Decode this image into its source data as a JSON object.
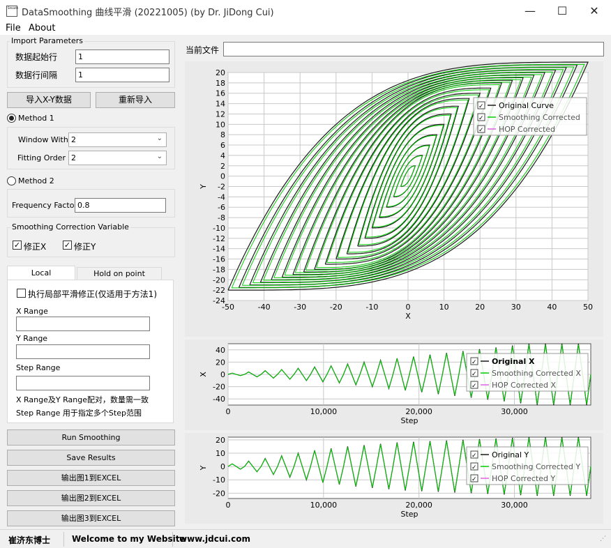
{
  "window": {
    "icon_text": "Smooth",
    "title": "DataSmoothing 曲线平滑 (20221005) (by Dr. JiDong Cui)",
    "minimize": "—",
    "maximize": "☐",
    "close": "✕"
  },
  "menu": {
    "file": "File",
    "about": "About"
  },
  "import": {
    "group_label": "Import Parameters",
    "start_row_label": "数据起始行",
    "start_row_value": "1",
    "row_interval_label": "数据行间隔",
    "row_interval_value": "1",
    "import_xy_button": "导入X-Y数据",
    "reimport_button": "重新导入"
  },
  "method1": {
    "label": "Method 1",
    "window_label": "Window With",
    "window_value": "2",
    "order_label": "Fitting Order",
    "order_value": "2"
  },
  "method2": {
    "label": "Method 2",
    "frequency_label": "Frequency Factor",
    "frequency_value": "0.8"
  },
  "correction": {
    "group_label": "Smoothing Correction Variable",
    "fix_x_label": "修正X",
    "fix_y_label": "修正Y",
    "fix_x_checked": "✓",
    "fix_y_checked": "✓"
  },
  "tabs": {
    "local": "Local Optimization",
    "hold": "Hold on point correction"
  },
  "local_panel": {
    "apply_label": "执行局部平滑修正(仅适用于方法1)",
    "x_range_label": "X Range",
    "y_range_label": "Y Range",
    "step_range_label": "Step Range",
    "note1": "X Range及Y Range配对，数量需一致",
    "note2": "Step Range 用于指定多个Step范围"
  },
  "actions": {
    "run": "Run Smoothing",
    "save": "Save Results",
    "export1": "输出图1到EXCEL",
    "export2": "输出图2到EXCEL",
    "export3": "输出图3到EXCEL"
  },
  "current_file": {
    "label": "当前文件",
    "value": ""
  },
  "status": {
    "author": "崔济东博士",
    "welcome": "Welcome to my Website",
    "site": "www.jdcui.com"
  },
  "chart_data": [
    {
      "type": "line",
      "xlabel": "X",
      "ylabel": "Y",
      "xlim": [
        -50,
        50
      ],
      "ylim": [
        -24,
        20
      ],
      "xticks": [
        "-50",
        "-40",
        "-30",
        "-20",
        "-10",
        "0",
        "10",
        "20",
        "30",
        "40",
        "50"
      ],
      "yticks": [
        "20",
        "18",
        "16",
        "14",
        "12",
        "10",
        "8",
        "6",
        "4",
        "2",
        "0",
        "-2",
        "-4",
        "-6",
        "-8",
        "-10",
        "-12",
        "-14",
        "-16",
        "-18",
        "-20",
        "-22",
        "-24"
      ],
      "legend": [
        "Original Curve",
        "Smoothing Corrected",
        "HOP Corrected"
      ],
      "legend_position": "top-right",
      "grid": true,
      "colors": {
        "original": "#1a1a1a",
        "smoothing": "#00cc00",
        "hop": "#e060e0"
      },
      "loop_amplitudes_x": [
        2,
        4,
        6,
        8,
        10,
        12,
        14,
        17,
        20,
        23,
        26,
        29,
        32,
        35,
        38,
        41,
        44,
        47,
        50
      ],
      "loop_amplitudes_y": [
        2,
        4,
        6,
        8,
        10,
        12,
        13.5,
        15,
        16,
        17,
        18,
        18.5,
        19,
        19.5,
        20,
        20.5,
        21,
        21.5,
        22
      ]
    },
    {
      "type": "line",
      "xlabel": "Step",
      "ylabel": "X",
      "xlim": [
        0,
        38000
      ],
      "ylim": [
        -50,
        50
      ],
      "xticks": [
        "0",
        "10,000",
        "20,000",
        "30,000"
      ],
      "yticks": [
        "40",
        "20",
        "0",
        "-20",
        "-40"
      ],
      "legend": [
        "Original X",
        "Smoothing Corrected X",
        "HOP Corrected X"
      ],
      "legend_position": "top-right",
      "grid": true,
      "cycle_peaks": [
        2,
        4,
        6,
        8,
        10,
        12,
        14,
        17,
        20,
        23,
        26,
        29,
        32,
        35,
        38,
        41,
        44,
        47,
        50,
        50,
        50,
        50
      ]
    },
    {
      "type": "line",
      "xlabel": "Step",
      "ylabel": "Y",
      "xlim": [
        0,
        38000
      ],
      "ylim": [
        -24,
        22
      ],
      "xticks": [
        "0",
        "10,000",
        "20,000",
        "30,000"
      ],
      "yticks": [
        "20",
        "10",
        "0",
        "-10",
        "-20"
      ],
      "legend": [
        "Original Y",
        "Smoothing Corrected Y",
        "HOP Corrected Y"
      ],
      "legend_position": "top-right",
      "grid": true,
      "cycle_peaks": [
        2,
        4,
        6,
        8,
        10,
        12,
        13.5,
        15,
        16,
        17,
        18,
        18.5,
        19,
        19.5,
        20,
        20.5,
        21,
        21.5,
        22,
        22,
        22,
        22
      ]
    }
  ]
}
